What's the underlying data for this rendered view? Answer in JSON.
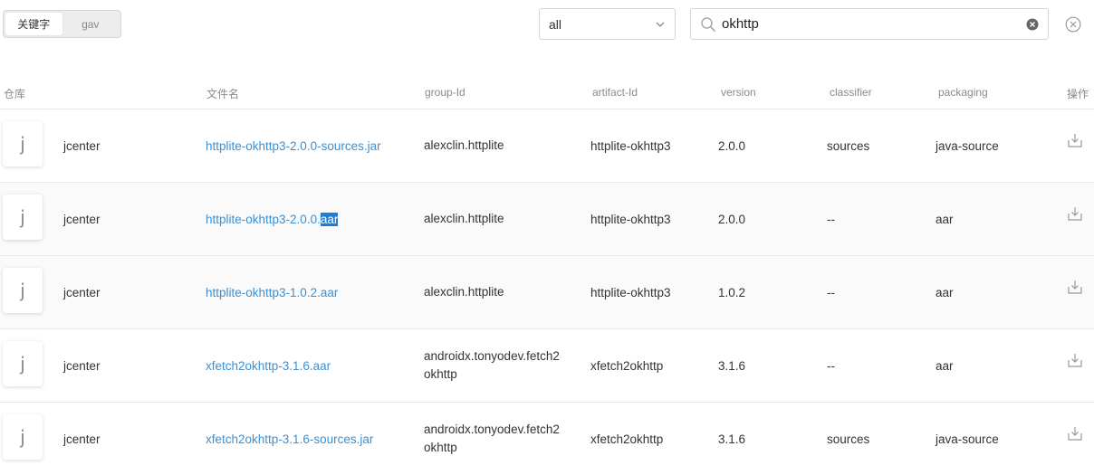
{
  "toolbar": {
    "seg_keyword": "关键字",
    "seg_gav": "gav",
    "repo_select": "all",
    "search_value": "okhttp"
  },
  "columns": {
    "repo": "仓库",
    "filename": "文件名",
    "group": "group-Id",
    "artifact": "artifact-Id",
    "version": "version",
    "classifier": "classifier",
    "packaging": "packaging",
    "action": "操作"
  },
  "rows": [
    {
      "avatar": "j",
      "repo": "jcenter",
      "file_name": "httplite-okhttp3-2.0.0-sources.jar",
      "group_l1": "alexclin.httplite",
      "group_l2": "",
      "artifact": "httplite-okhttp3",
      "version": "2.0.0",
      "classifier": "sources",
      "packaging": "java-source"
    },
    {
      "avatar": "j",
      "repo": "jcenter",
      "file_name": "httplite-okhttp3-2.0.0.",
      "file_sel": "aar",
      "group_l1": "alexclin.httplite",
      "group_l2": "",
      "artifact": "httplite-okhttp3",
      "version": "2.0.0",
      "classifier": "--",
      "packaging": "aar"
    },
    {
      "avatar": "j",
      "repo": "jcenter",
      "file_name": "httplite-okhttp3-1.0.2.aar",
      "group_l1": "alexclin.httplite",
      "group_l2": "",
      "artifact": "httplite-okhttp3",
      "version": "1.0.2",
      "classifier": "--",
      "packaging": "aar"
    },
    {
      "avatar": "j",
      "repo": "jcenter",
      "file_name": "xfetch2okhttp-3.1.6.aar",
      "group_l1": "androidx.tonyodev.fetch2",
      "group_l2": "okhttp",
      "artifact": "xfetch2okhttp",
      "version": "3.1.6",
      "classifier": "--",
      "packaging": "aar"
    },
    {
      "avatar": "j",
      "repo": "jcenter",
      "file_name": "xfetch2okhttp-3.1.6-sources.jar",
      "group_l1": "androidx.tonyodev.fetch2",
      "group_l2": "okhttp",
      "artifact": "xfetch2okhttp",
      "version": "3.1.6",
      "classifier": "sources",
      "packaging": "java-source"
    }
  ],
  "icons": {
    "chevron": "chevron-down-icon",
    "search": "search-icon",
    "clear": "clear-icon",
    "close": "close-circle-icon",
    "download": "download-icon"
  },
  "colors": {
    "link": "#3d8fd1",
    "selection": "#1e7ed6"
  }
}
